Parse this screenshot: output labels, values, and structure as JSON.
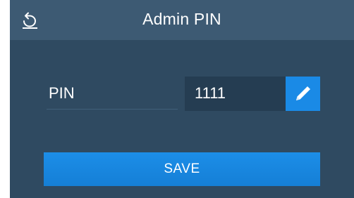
{
  "header": {
    "title": "Admin PIN",
    "back_icon": "back-arrow-icon"
  },
  "form": {
    "pin_label": "PIN",
    "pin_value": "1111",
    "edit_icon": "pencil-icon"
  },
  "actions": {
    "save_label": "SAVE"
  },
  "colors": {
    "panel_background": "#2f4a61",
    "header_background": "#3d5a73",
    "field_background": "#253d52",
    "accent_blue": "#1a8ae6",
    "text": "#ffffff"
  }
}
